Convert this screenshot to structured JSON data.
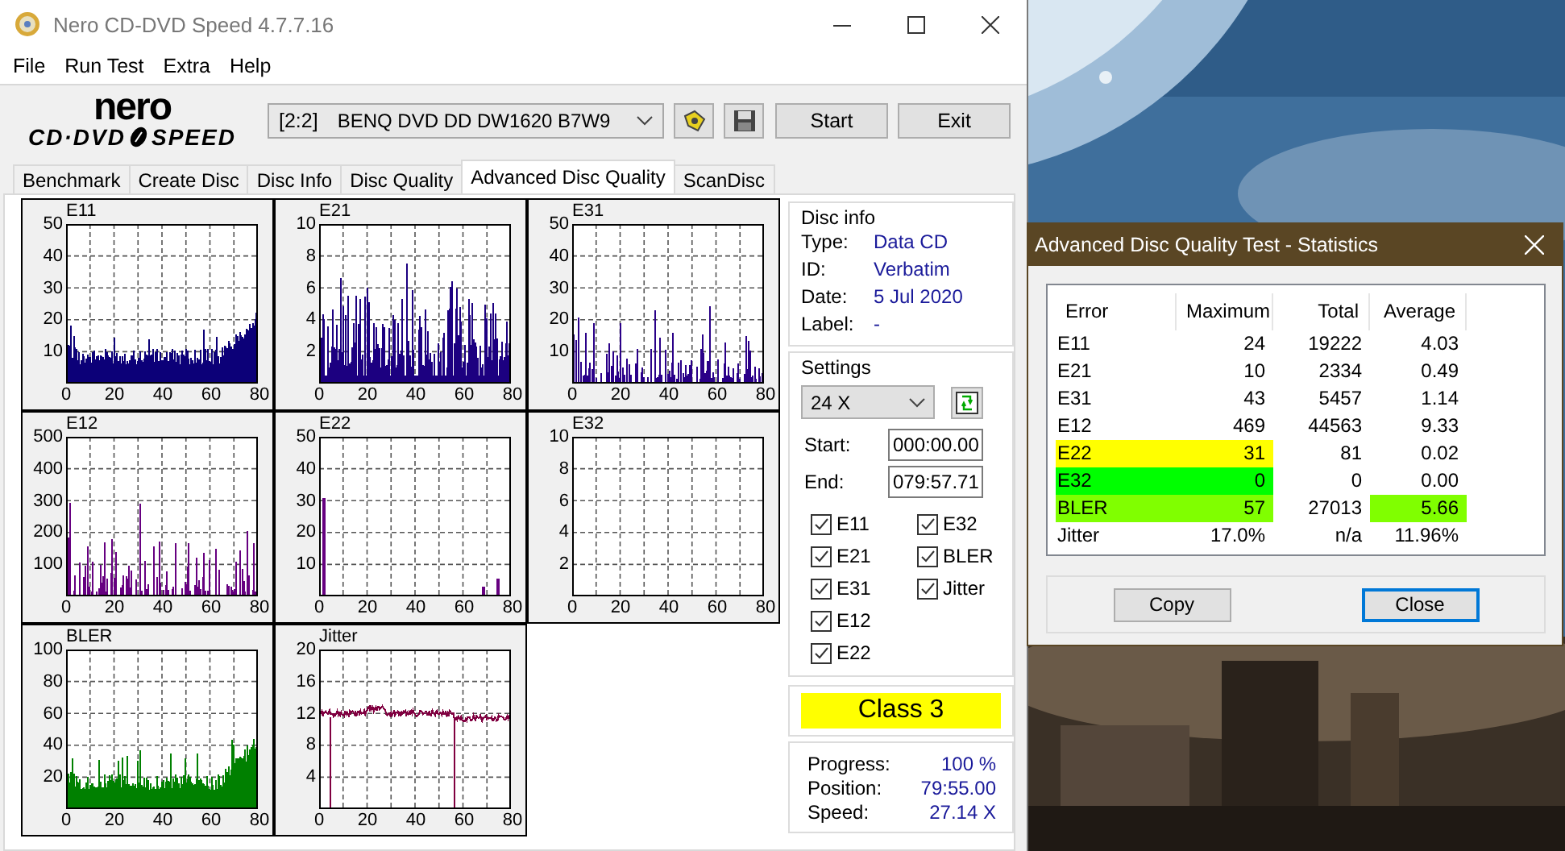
{
  "window": {
    "title": "Nero CD-DVD Speed 4.7.7.16"
  },
  "menu": [
    "File",
    "Run Test",
    "Extra",
    "Help"
  ],
  "logo": {
    "brand": "nero",
    "product_left": "CD·DVD",
    "product_right": "SPEED"
  },
  "drive": {
    "port": "[2:2]",
    "name": "BENQ DVD DD DW1620 B7W9"
  },
  "toolbar_buttons": [
    "Start",
    "Exit"
  ],
  "tabs": [
    {
      "label": "Benchmark",
      "selected": false
    },
    {
      "label": "Create Disc",
      "selected": false
    },
    {
      "label": "Disc Info",
      "selected": false
    },
    {
      "label": "Disc Quality",
      "selected": false
    },
    {
      "label": "Advanced Disc Quality",
      "selected": true
    },
    {
      "label": "ScanDisc",
      "selected": false
    }
  ],
  "charts": [
    {
      "title": "E11",
      "kind": "baseline",
      "color": "#0c0078",
      "yticks": [
        "50",
        "40",
        "30",
        "20",
        "10"
      ],
      "xticks": [
        "0",
        "20",
        "40",
        "60",
        "80"
      ]
    },
    {
      "title": "E21",
      "kind": "noisy",
      "color": "#1c0080",
      "yticks": [
        "10",
        "8",
        "6",
        "4",
        "2"
      ],
      "xticks": [
        "0",
        "20",
        "40",
        "60",
        "80"
      ]
    },
    {
      "title": "E31",
      "kind": "sparse",
      "color": "#2a0088",
      "yticks": [
        "50",
        "40",
        "30",
        "20",
        "10"
      ],
      "xticks": [
        "0",
        "20",
        "40",
        "60",
        "80"
      ]
    },
    {
      "title": "E12",
      "kind": "sparse",
      "color": "#660080",
      "yticks": [
        "500",
        "400",
        "300",
        "200",
        "100"
      ],
      "xticks": [
        "0",
        "20",
        "40",
        "60",
        "80"
      ]
    },
    {
      "title": "E22",
      "kind": "few",
      "color": "#660080",
      "yticks": [
        "50",
        "40",
        "30",
        "20",
        "10"
      ],
      "xticks": [
        "0",
        "20",
        "40",
        "60",
        "80"
      ]
    },
    {
      "title": "E32",
      "kind": "empty",
      "yticks": [
        "10",
        "8",
        "6",
        "4",
        "2"
      ],
      "xticks": [
        "0",
        "20",
        "40",
        "60",
        "80"
      ]
    },
    {
      "title": "BLER",
      "kind": "baseline",
      "color": "#008000",
      "yticks": [
        "100",
        "80",
        "60",
        "40",
        "20"
      ],
      "xticks": [
        "0",
        "20",
        "40",
        "60",
        "80"
      ]
    },
    {
      "title": "Jitter",
      "kind": "line",
      "color": "#800040",
      "yticks": [
        "20",
        "16",
        "12",
        "8",
        "4"
      ],
      "xticks": [
        "0",
        "20",
        "40",
        "60",
        "80"
      ]
    }
  ],
  "disc_info": {
    "title": "Disc info",
    "fields": [
      {
        "label": "Type:",
        "value": "Data CD"
      },
      {
        "label": "ID:",
        "value": "Verbatim"
      },
      {
        "label": "Date:",
        "value": "5 Jul 2020"
      },
      {
        "label": "Label:",
        "value": "-"
      }
    ]
  },
  "settings": {
    "title": "Settings",
    "speed": "24 X",
    "start_label": "Start:",
    "start": "000:00.00",
    "end_label": "End:",
    "end": "079:57.71",
    "checks": [
      {
        "label": "E11",
        "checked": true
      },
      {
        "label": "E21",
        "checked": true
      },
      {
        "label": "E31",
        "checked": true
      },
      {
        "label": "E12",
        "checked": true
      },
      {
        "label": "E22",
        "checked": true
      },
      {
        "label": "E32",
        "checked": true
      },
      {
        "label": "BLER",
        "checked": true
      },
      {
        "label": "Jitter",
        "checked": true
      }
    ]
  },
  "class_badge": "Class 3",
  "progress": [
    {
      "label": "Progress:",
      "value": "100 %"
    },
    {
      "label": "Position:",
      "value": "79:55.00"
    },
    {
      "label": "Speed:",
      "value": "27.14 X"
    }
  ],
  "stats_dialog": {
    "title": "Advanced Disc Quality Test - Statistics",
    "columns": [
      "Error",
      "Maximum",
      "Total",
      "Average"
    ],
    "rows": [
      {
        "cells": [
          {
            "text": "E11"
          },
          {
            "text": "24"
          },
          {
            "text": "19222"
          },
          {
            "text": "4.03"
          }
        ]
      },
      {
        "cells": [
          {
            "text": "E21"
          },
          {
            "text": "10"
          },
          {
            "text": "2334"
          },
          {
            "text": "0.49"
          }
        ]
      },
      {
        "cells": [
          {
            "text": "E31"
          },
          {
            "text": "43"
          },
          {
            "text": "5457"
          },
          {
            "text": "1.14"
          }
        ]
      },
      {
        "cells": [
          {
            "text": "E12"
          },
          {
            "text": "469"
          },
          {
            "text": "44563"
          },
          {
            "text": "9.33"
          }
        ]
      },
      {
        "cells": [
          {
            "text": "E22",
            "color": "#ffff00"
          },
          {
            "text": "31",
            "color": "#ffff00"
          },
          {
            "text": "81"
          },
          {
            "text": "0.02"
          }
        ]
      },
      {
        "cells": [
          {
            "text": "E32",
            "color": "#00ff00"
          },
          {
            "text": "0",
            "color": "#00ff00"
          },
          {
            "text": "0"
          },
          {
            "text": "0.00"
          }
        ]
      },
      {
        "cells": [
          {
            "text": "BLER",
            "color": "#80ff00"
          },
          {
            "text": "57",
            "color": "#80ff00"
          },
          {
            "text": "27013"
          },
          {
            "text": "5.66",
            "color": "#80ff00"
          }
        ]
      },
      {
        "cells": [
          {
            "text": "Jitter"
          },
          {
            "text": "17.0%"
          },
          {
            "text": "n/a"
          },
          {
            "text": "11.96%"
          }
        ]
      }
    ],
    "buttons": [
      {
        "label": "Copy",
        "default": false
      },
      {
        "label": "Close",
        "default": true
      }
    ]
  }
}
